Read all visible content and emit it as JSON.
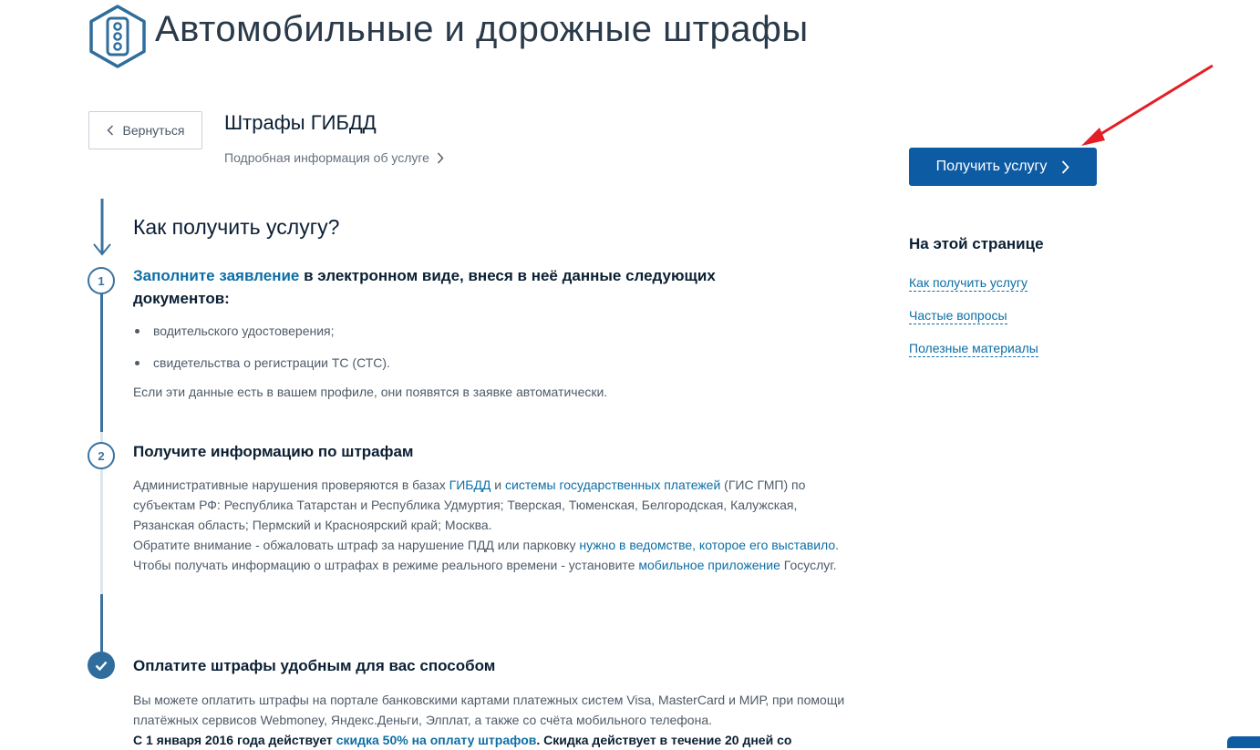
{
  "header": {
    "title": "Автомобильные и дорожные штрафы",
    "logo_icon": "traffic-light-icon"
  },
  "service": {
    "back_label": "Вернуться",
    "title": "Штрафы ГИБДД",
    "info_link": "Подробная информация об услуге"
  },
  "how": {
    "title": "Как получить услугу?",
    "step1": {
      "number": "1",
      "link": "Заполните заявление",
      "text": " в электронном виде, внеся в неё данные следующих документов:",
      "bullets": [
        "водительского удостоверения;",
        "свидетельства о регистрации ТС (СТС)."
      ],
      "note": "Если эти данные есть в вашем профиле, они появятся в заявке автоматически."
    },
    "step2": {
      "number": "2",
      "title": "Получите информацию по штрафам",
      "p1_a": "Административные нарушения проверяются в базах ",
      "p1_link1": "ГИБДД",
      "p1_b": " и ",
      "p1_link2": "системы государственных платежей",
      "p1_c": " (ГИС ГМП) по субъектам РФ: Республика Татарстан и Республика Удмуртия; Тверская, Тюменская, Белгородская, Калужская, Рязанская область; Пермский и Красноярский край; Москва.",
      "p2_a": "Обратите внимание - обжаловать штраф за нарушение ПДД или парковку ",
      "p2_link": "нужно в ведомстве, которое его выставило",
      "p2_b": ".",
      "p3_a": "Чтобы получать информацию о штрафах в режиме реального времени - установите ",
      "p3_link": "мобильное приложение",
      "p3_b": " Госуслуг."
    },
    "step3": {
      "title": "Оплатите штрафы удобным для вас способом",
      "p1": "Вы можете оплатить штрафы на портале банковскими картами платежных систем Visa, MasterCard и МИР, при помощи платёжных сервисов Webmoney, Яндекс.Деньги, Элплат, а также со счёта мобильного телефона.",
      "p2_a": "С 1 января 2016 года действует ",
      "p2_link": "скидка 50% на оплату штрафов",
      "p2_b": ". Скидка действует в течение 20 дней со"
    }
  },
  "sidebar": {
    "get_service_label": "Получить услугу",
    "toc_title": "На этой странице",
    "toc_links": [
      "Как получить услугу",
      "Частые вопросы",
      "Полезные материалы"
    ]
  },
  "colors": {
    "primary": "#0d5ba3",
    "link": "#0d6ea5",
    "timeline": "#3a73a0",
    "annotation_arrow": "#e31e24"
  }
}
